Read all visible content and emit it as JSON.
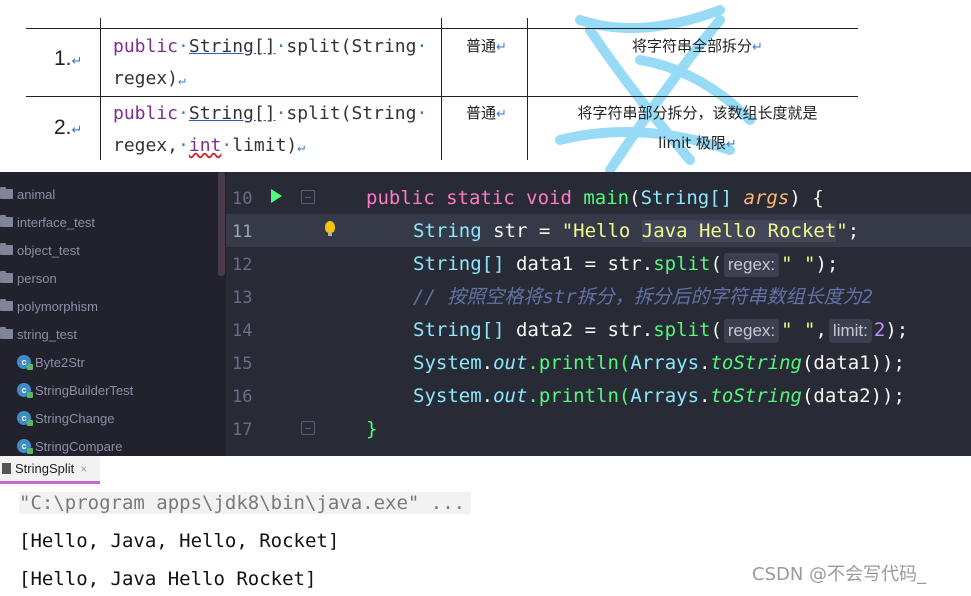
{
  "doc_table": {
    "rows": [
      {
        "num": "1.",
        "sig_line1_kw": "public",
        "sig_line1_type": "String[]",
        "sig_line1_rest": "split(String",
        "sig_line2": "regex)",
        "type": "普通",
        "desc_line1": "将字符串全部拆分",
        "desc_line2": ""
      },
      {
        "num": "2.",
        "sig_line1_kw": "public",
        "sig_line1_type": "String[]",
        "sig_line1_rest": "split(String",
        "sig_line2_a": "regex,",
        "sig_line2_int": "int",
        "sig_line2_b": "limit)",
        "type": "普通",
        "desc_line1": "将字符串部分拆分，该数组长度就是",
        "desc_line2": "limit 极限"
      }
    ],
    "return_mark": "↵"
  },
  "project_tree": {
    "folders": [
      "animal",
      "interface_test",
      "object_test",
      "person",
      "polymorphism",
      "string_test"
    ],
    "classes": [
      "Byte2Str",
      "StringBuilderTest",
      "StringChange",
      "StringCompare"
    ]
  },
  "editor": {
    "line_numbers": [
      "10",
      "11",
      "12",
      "13",
      "14",
      "15",
      "16",
      "17"
    ],
    "current_line": "11",
    "lines": {
      "l10": {
        "kw": "public static void",
        "fn": "main",
        "p1": "(",
        "ty": "String[]",
        "arg": "args",
        "p2": ") {"
      },
      "l11": {
        "ty": "String",
        "var": " str = ",
        "str_a": "\"Hello ",
        "str_hl": "Java Hello Rocket",
        "str_b": "\"",
        "end": ";"
      },
      "l12": {
        "ty": "String[]",
        "a": " data1 = str.",
        "fn": "split",
        "p": "(",
        "hint": "regex:",
        "str": "\" \"",
        "end": ");"
      },
      "l13": {
        "comment": "// 按照空格将str拆分，拆分后的字符串数组长度为2"
      },
      "l14": {
        "ty": "String[]",
        "a": " data2 = str.",
        "fn": "split",
        "p": "(",
        "hint1": "regex:",
        "str": "\" \"",
        "comma": ",",
        "hint2": "limit:",
        "num": "2",
        "end": ");"
      },
      "l15": {
        "ty1": "System",
        "dot": ".",
        "out": "out",
        "fn": ".println(",
        "ty2": "Arrays",
        "dot2": ".",
        "sfn": "toString",
        "arg": "(data1));"
      },
      "l16": {
        "ty1": "System",
        "dot": ".",
        "out": "out",
        "fn": ".println(",
        "ty2": "Arrays",
        "dot2": ".",
        "sfn": "toString",
        "arg": "(data2));"
      },
      "l17": {
        "brace": "}"
      }
    }
  },
  "run_panel": {
    "tab_label": "StringSplit",
    "close": "×",
    "cmd": "\"C:\\program apps\\jdk8\\bin\\java.exe\" ...",
    "out1": "[Hello, Java, Hello, Rocket]",
    "out2": "[Hello, Java Hello Rocket]"
  },
  "watermark": "CSDN @不会写代码_",
  "colors": {
    "ide_bg": "#282a36",
    "keyword": "#ff79c6",
    "function": "#50fa7b",
    "type": "#8be9fd",
    "string": "#f1fa8c",
    "param": "#ffb86c",
    "comment": "#6272a4",
    "watermark_blue": "#7fd3f5"
  }
}
